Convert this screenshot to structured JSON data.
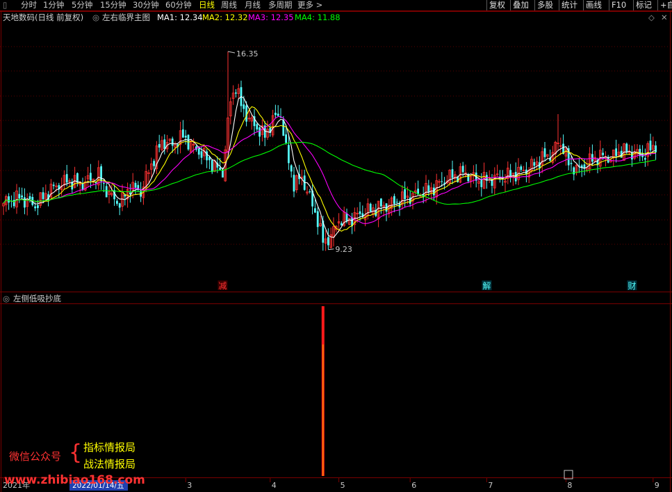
{
  "topbar": {
    "timeframes": [
      {
        "label": "分时",
        "x": 30
      },
      {
        "label": "1分钟",
        "x": 62
      },
      {
        "label": "5分钟",
        "x": 103
      },
      {
        "label": "15分钟",
        "x": 144
      },
      {
        "label": "30分钟",
        "x": 191
      },
      {
        "label": "60分钟",
        "x": 238
      },
      {
        "label": "日线",
        "x": 286,
        "active": true
      },
      {
        "label": "周线",
        "x": 318
      },
      {
        "label": "月线",
        "x": 352
      },
      {
        "label": "多周期",
        "x": 386
      },
      {
        "label": "更多 >",
        "x": 428
      }
    ],
    "buttons": [
      {
        "label": "复权",
        "x": 700
      },
      {
        "label": "叠加",
        "x": 734
      },
      {
        "label": "多股",
        "x": 769
      },
      {
        "label": "统计",
        "x": 804
      },
      {
        "label": "画线",
        "x": 839
      },
      {
        "label": "F10",
        "x": 876
      },
      {
        "label": "标记",
        "x": 911
      },
      {
        "label": "+自",
        "x": 946
      }
    ]
  },
  "main_info": {
    "stock_name": "天地数码(日线 前复权)",
    "indicator_name": "左右临界主图",
    "ma1": "MA1: 12.34",
    "ma2": "MA2: 12.32",
    "ma3": "MA3: 12.35",
    "ma4": "MA4: 11.88"
  },
  "sub_info": {
    "indicator_name": "左侧低吸抄底"
  },
  "colors": {
    "up": "#ff3232",
    "down": "#54fcfc",
    "ma1": "#ffffff",
    "ma2": "#ffff00",
    "ma3": "#ff00ff",
    "ma4": "#00ff00",
    "grid": "#7a0000"
  },
  "chart_data": {
    "type": "candlestick",
    "y_range": [
      8.5,
      17.3
    ],
    "high_label": "16.35",
    "low_label": "9.23",
    "markers": [
      {
        "text": "减",
        "bar": 83,
        "color": "#ff3232"
      },
      {
        "text": "解",
        "bar": 183,
        "color": "#54fcfc"
      },
      {
        "text": "财",
        "bar": 238,
        "color": "#54fcfc"
      }
    ],
    "x_axis_labels": [
      {
        "text": "2021年",
        "bar": 0
      },
      {
        "text": "3",
        "bar": 69
      },
      {
        "text": "4",
        "bar": 101
      },
      {
        "text": "5",
        "bar": 127
      },
      {
        "text": "6",
        "bar": 154
      },
      {
        "text": "7",
        "bar": 183
      },
      {
        "text": "8",
        "bar": 213
      },
      {
        "text": "9",
        "bar": 246
      }
    ],
    "crosshair_date": "2022/01/14/五",
    "anchors": [
      [
        0,
        10.9
      ],
      [
        6,
        11.1
      ],
      [
        12,
        10.8
      ],
      [
        18,
        11.4
      ],
      [
        24,
        11.7
      ],
      [
        30,
        11.6
      ],
      [
        36,
        11.9
      ],
      [
        40,
        11.2
      ],
      [
        44,
        10.9
      ],
      [
        48,
        11.5
      ],
      [
        52,
        11.3
      ],
      [
        56,
        12.3
      ],
      [
        60,
        13.1
      ],
      [
        64,
        13.0
      ],
      [
        68,
        13.3
      ],
      [
        72,
        12.9
      ],
      [
        76,
        12.6
      ],
      [
        80,
        12.2
      ],
      [
        83,
        12.0
      ],
      [
        86,
        14.6
      ],
      [
        88,
        15.1
      ],
      [
        90,
        14.4
      ],
      [
        93,
        13.9
      ],
      [
        96,
        13.6
      ],
      [
        99,
        13.3
      ],
      [
        102,
        13.9
      ],
      [
        105,
        14.1
      ],
      [
        107,
        12.8
      ],
      [
        110,
        11.6
      ],
      [
        113,
        11.8
      ],
      [
        116,
        11.1
      ],
      [
        119,
        10.3
      ],
      [
        121,
        9.5
      ],
      [
        124,
        9.7
      ],
      [
        127,
        10.3
      ],
      [
        131,
        10.3
      ],
      [
        135,
        10.5
      ],
      [
        140,
        10.7
      ],
      [
        145,
        10.8
      ],
      [
        150,
        11.0
      ],
      [
        156,
        11.2
      ],
      [
        162,
        11.4
      ],
      [
        168,
        11.8
      ],
      [
        174,
        12.0
      ],
      [
        180,
        11.7
      ],
      [
        186,
        11.8
      ],
      [
        192,
        11.9
      ],
      [
        198,
        12.1
      ],
      [
        204,
        12.5
      ],
      [
        208,
        12.7
      ],
      [
        210,
        13.1
      ],
      [
        212,
        12.9
      ],
      [
        214,
        12.3
      ],
      [
        218,
        12.1
      ],
      [
        222,
        12.4
      ],
      [
        226,
        12.6
      ],
      [
        230,
        12.5
      ],
      [
        234,
        12.8
      ],
      [
        238,
        12.7
      ],
      [
        242,
        12.6
      ],
      [
        247,
        13.0
      ]
    ],
    "spikes": [
      {
        "bar": 85,
        "high": 16.35
      },
      {
        "bar": 123,
        "low": 9.23
      },
      {
        "bar": 210,
        "high": 14.1
      }
    ],
    "signal": {
      "bar": 121,
      "value": 100
    }
  },
  "watermark": {
    "label": "微信公众号",
    "line1": "指标情报局",
    "line2": "战法情报局",
    "url": "www.zhibiao168.com"
  }
}
